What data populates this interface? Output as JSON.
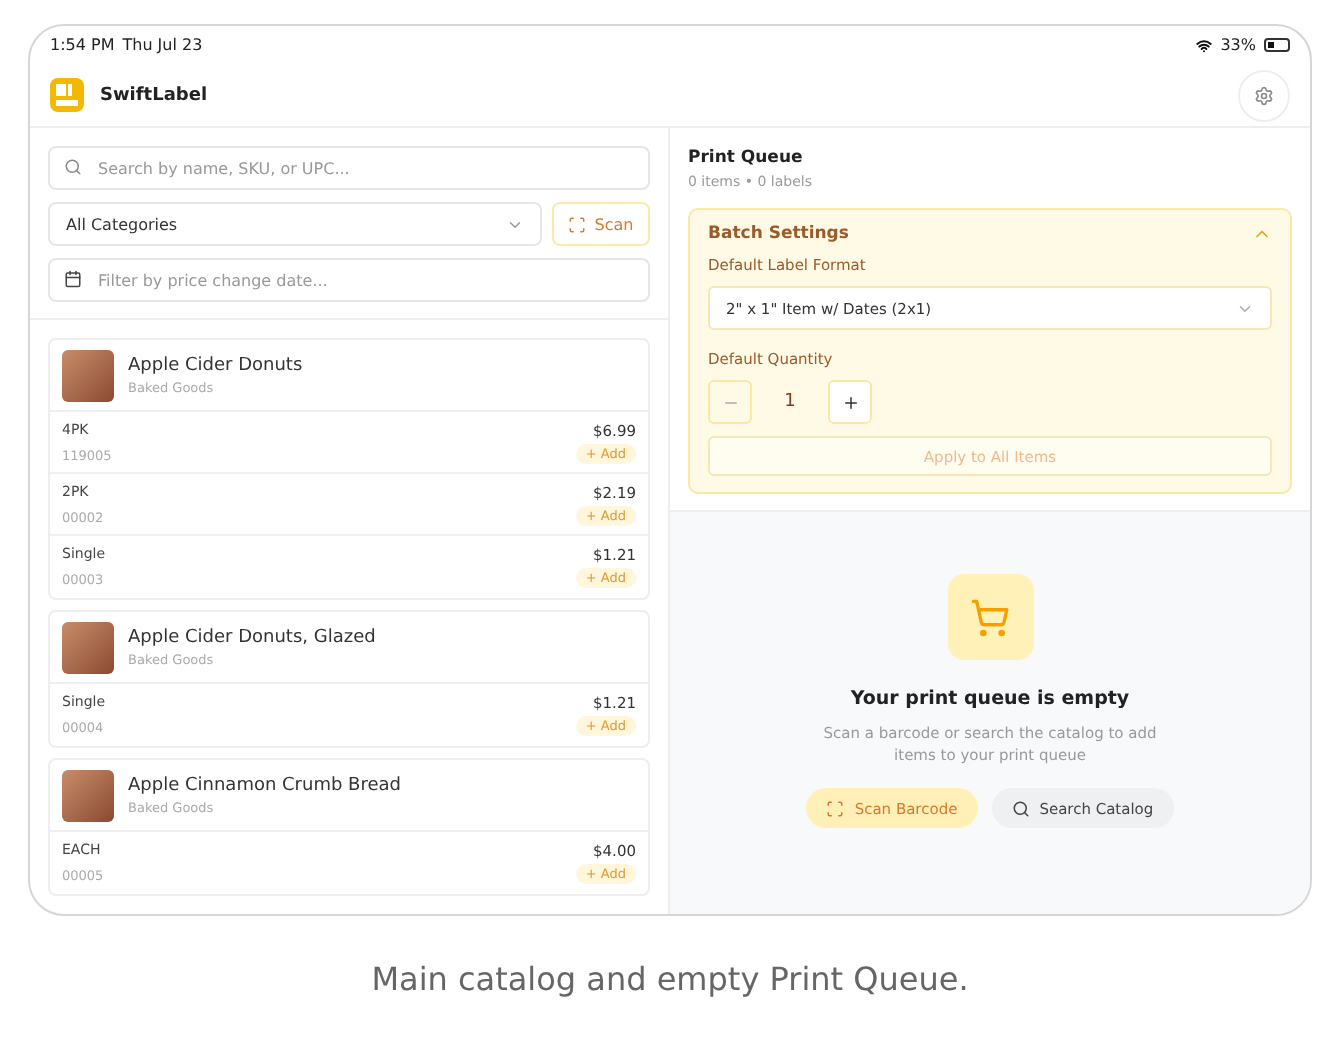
{
  "status_bar": {
    "time": "1:54 PM",
    "date": "Thu Jul 23",
    "battery": "33%"
  },
  "header": {
    "app_name": "SwiftLabel"
  },
  "catalog": {
    "search": {
      "placeholder": "Search by name, SKU, or UPC..."
    },
    "category": {
      "value": "All Categories"
    },
    "scan_button": "Scan",
    "date_filter": {
      "placeholder": "Filter by price change date..."
    },
    "products": [
      {
        "name": "Apple Cider Donuts",
        "category": "Baked Goods",
        "variants": [
          {
            "name": "4PK",
            "sku": "119005",
            "price": "$6.99",
            "add": "+ Add"
          },
          {
            "name": "2PK",
            "sku": "00002",
            "price": "$2.19",
            "add": "+ Add"
          },
          {
            "name": "Single",
            "sku": "00003",
            "price": "$1.21",
            "add": "+ Add"
          }
        ]
      },
      {
        "name": "Apple Cider Donuts, Glazed",
        "category": "Baked Goods",
        "variants": [
          {
            "name": "Single",
            "sku": "00004",
            "price": "$1.21",
            "add": "+ Add"
          }
        ]
      },
      {
        "name": "Apple Cinnamon Crumb Bread",
        "category": "Baked Goods",
        "variants": [
          {
            "name": "EACH",
            "sku": "00005",
            "price": "$4.00",
            "add": "+ Add"
          }
        ]
      }
    ]
  },
  "print_queue": {
    "title": "Print Queue",
    "summary": "0 items • 0 labels",
    "batch_settings": {
      "title": "Batch Settings",
      "expanded": true,
      "format_label": "Default Label Format",
      "format_value": "2\" x 1\" Item w/ Dates (2x1)",
      "quantity_label": "Default Quantity",
      "quantity": "1",
      "apply_button": "Apply to All Items",
      "apply_disabled": true
    },
    "empty_state": {
      "title": "Your print queue is empty",
      "message": "Scan a barcode or search the catalog to add items to your print queue",
      "scan_button": "Scan Barcode",
      "search_button": "Search Catalog"
    }
  },
  "caption": "Main catalog and empty Print Queue."
}
